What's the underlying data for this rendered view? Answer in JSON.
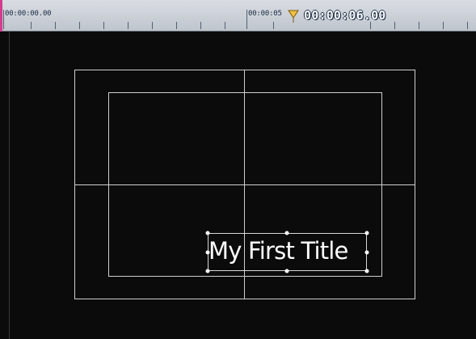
{
  "timeline": {
    "start_timecode": "00:00:00.00",
    "mid_timecode": "00:00:05",
    "current_timecode": "00:00:06.00"
  },
  "preview": {
    "title_text": "My First Title"
  },
  "colors": {
    "ruler_bg": "#c9ced6",
    "start_marker": "#d43d8f",
    "cti_marker": "#f0c040",
    "guides": "#cfcfcf",
    "canvas_bg": "#0b0b0b"
  },
  "icons": {
    "cti": "playhead-triangle-icon"
  }
}
